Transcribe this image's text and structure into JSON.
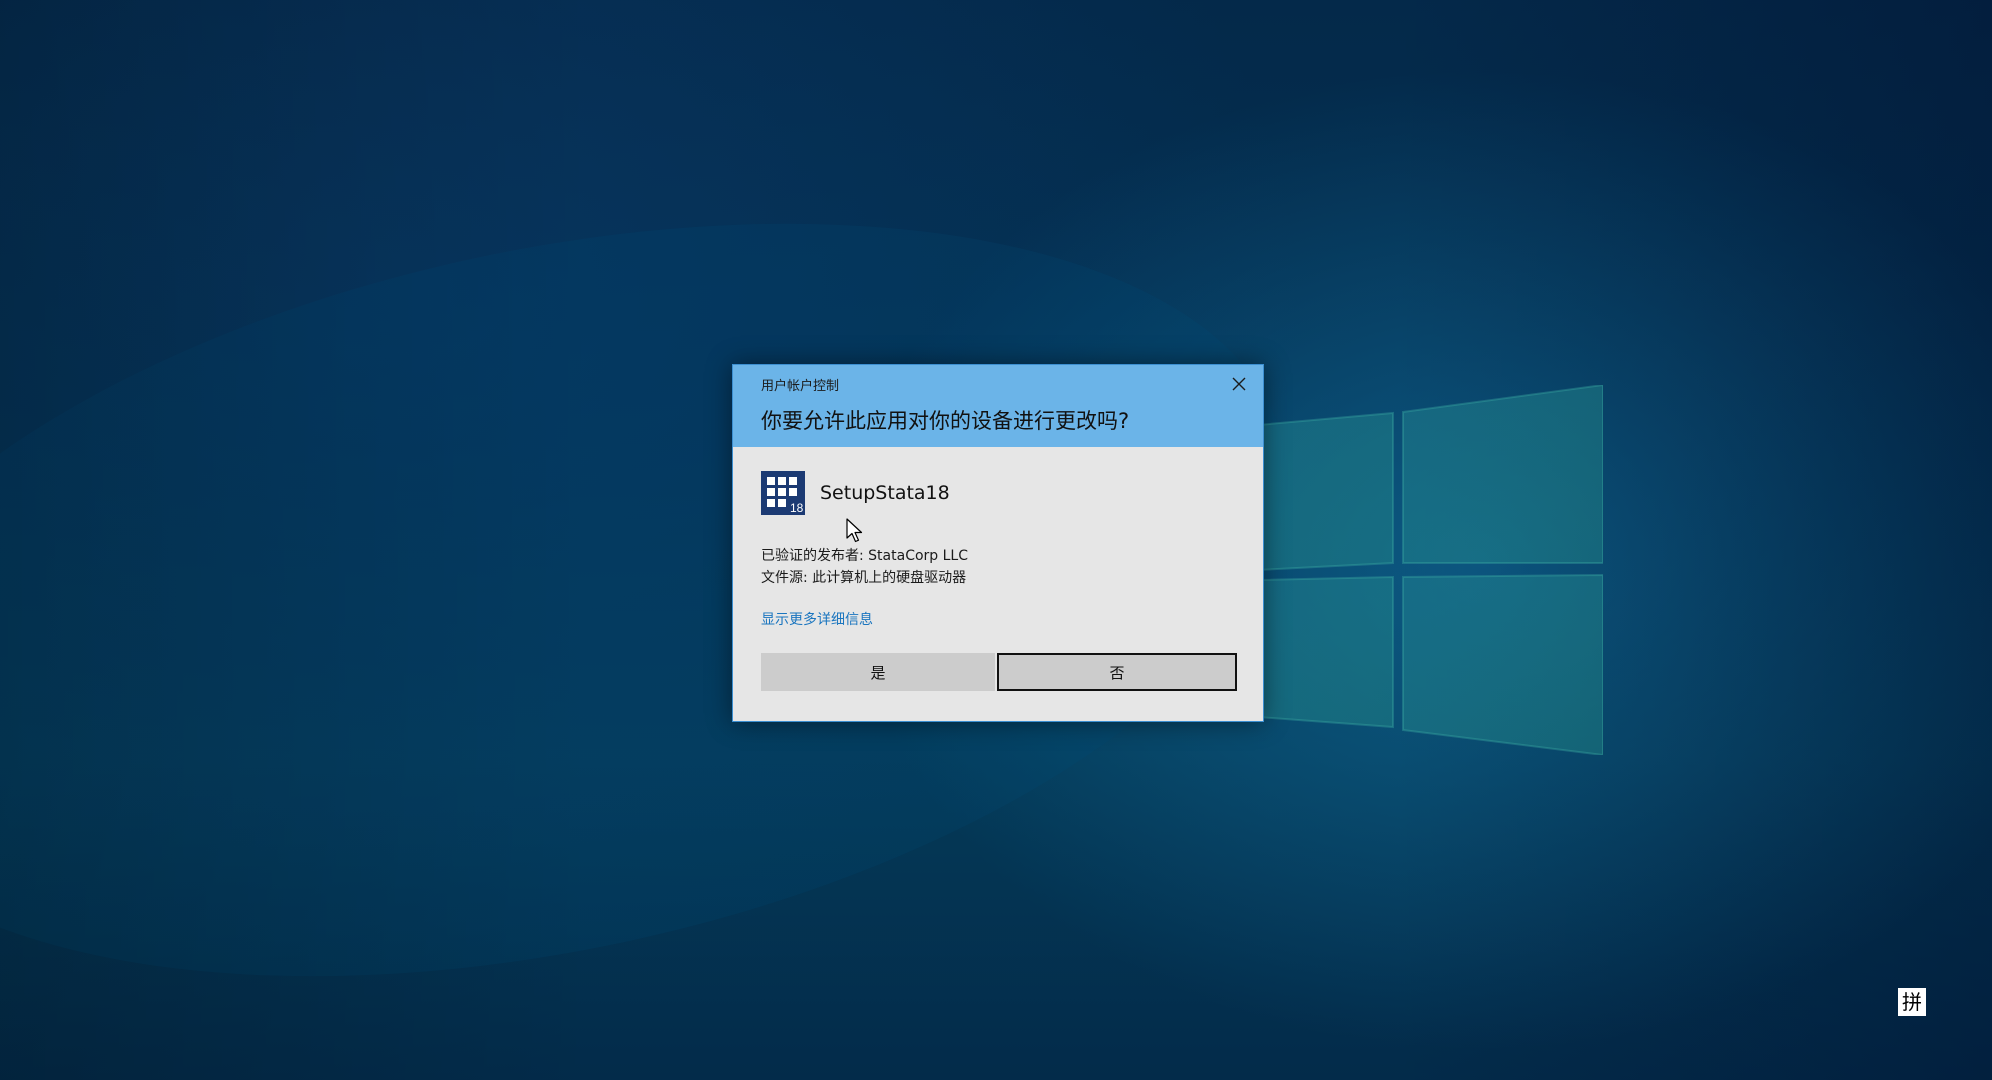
{
  "dialog": {
    "caption": "用户帐户控制",
    "question": "你要允许此应用对你的设备进行更改吗?",
    "app_name": "SetupStata18",
    "publisher_line": "已验证的发布者: StataCorp LLC",
    "source_line": "文件源: 此计算机上的硬盘驱动器",
    "more_details_link": "显示更多详细信息",
    "yes_label": "是",
    "no_label": "否",
    "app_icon_badge": "18",
    "header_color": "#6bb4e8",
    "link_color": "#1a75bf"
  },
  "taskbar": {
    "ime_indicator": "拼"
  },
  "icons": {
    "close": "close-icon",
    "app": "stata-app-icon",
    "cursor": "mouse-cursor-icon",
    "windows_logo": "windows-logo-icon"
  }
}
